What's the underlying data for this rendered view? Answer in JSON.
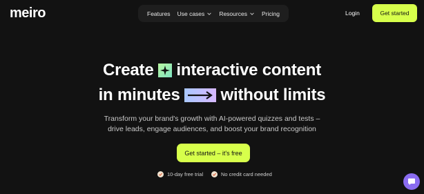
{
  "brand": {
    "logo_text": "meiro"
  },
  "nav": {
    "items": [
      {
        "label": "Features",
        "has_dropdown": false
      },
      {
        "label": "Use cases",
        "has_dropdown": true
      },
      {
        "label": "Resources",
        "has_dropdown": true
      },
      {
        "label": "Pricing",
        "has_dropdown": false
      }
    ],
    "login_label": "Login",
    "get_started_label": "Get started"
  },
  "hero": {
    "line1_before": "Create",
    "line1_after": "interactive content",
    "line2_before": "in minutes",
    "line2_after": "without limits",
    "subtitle_line1": "Transform your brand's growth with AI-powered quizzes and tests –",
    "subtitle_line2": "drive leads, engage audiences, and boost your brand recognition",
    "cta_label": "Get started – it's free",
    "perks": [
      "10-day free trial",
      "No credit card needed"
    ]
  },
  "icons": {
    "hero_icon_1": "sparkle-tile-icon",
    "hero_icon_2": "gradient-arrow-icon",
    "check": "check-circle-icon",
    "chat": "chat-bubble-icon"
  },
  "colors": {
    "background": "#121212",
    "accent": "#d7ff4b",
    "chat": "#8a6cf0"
  }
}
